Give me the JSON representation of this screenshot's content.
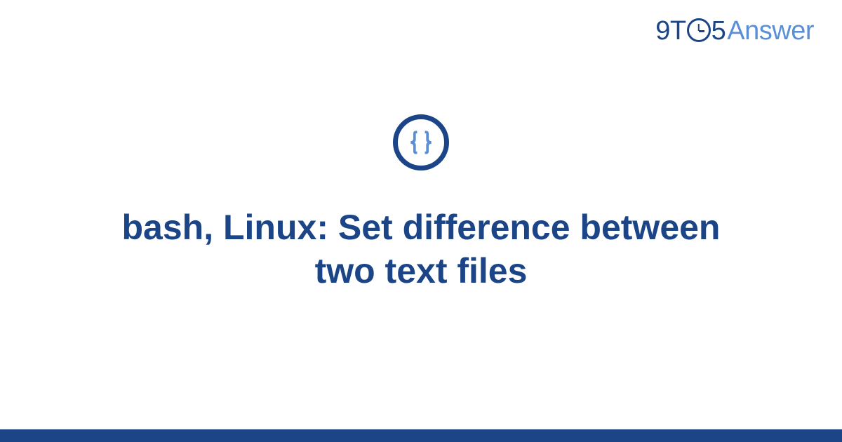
{
  "brand": {
    "part1": "9T",
    "part2": "5",
    "part3": "Answer"
  },
  "category": {
    "icon_name": "code-braces-icon"
  },
  "title": "bash, Linux: Set difference between two text files",
  "colors": {
    "primary": "#1b4586",
    "accent": "#5a8fd6"
  }
}
